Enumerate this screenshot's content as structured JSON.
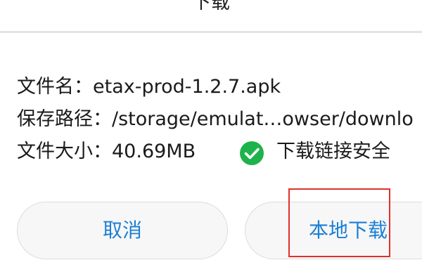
{
  "dialog": {
    "title": "下载"
  },
  "info": {
    "filename_label": "文件名：",
    "filename_value": "etax-prod-1.2.7.apk",
    "path_label": "保存路径：",
    "path_value": "/storage/emulat…owser/downlo",
    "size_label": "文件大小：",
    "size_value": "40.69MB",
    "safe_text": "下载链接安全",
    "safe_icon": "check-circle-icon",
    "safe_color": "#1db34a"
  },
  "buttons": {
    "cancel_label": "取消",
    "local_download_label": "本地下载",
    "accent_color": "#1b7fd6"
  },
  "highlight": {
    "color": "#e0302c"
  }
}
